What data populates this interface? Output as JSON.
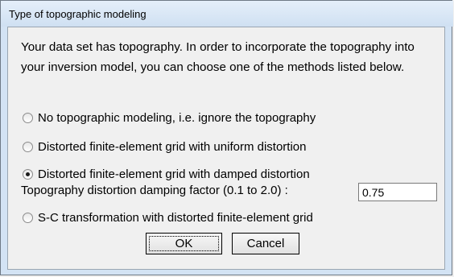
{
  "window": {
    "title": "Type of topographic modeling"
  },
  "dialog": {
    "intro_text": "Your data set has topography. In order to incorporate the topography into your inversion model, you can choose one of the methods listed below.",
    "options": [
      {
        "label": "No topographic modeling, i.e. ignore the topography",
        "checked": false
      },
      {
        "label": "Distorted finite-element grid with uniform distortion",
        "checked": false
      },
      {
        "label": "Distorted finite-element grid with damped distortion",
        "checked": true
      },
      {
        "label": "S-C transformation with distorted finite-element grid",
        "checked": false
      }
    ],
    "damping": {
      "label": "Topography distortion damping factor (0.1 to 2.0) :",
      "value": "0.75"
    },
    "buttons": {
      "ok": "OK",
      "cancel": "Cancel"
    }
  }
}
